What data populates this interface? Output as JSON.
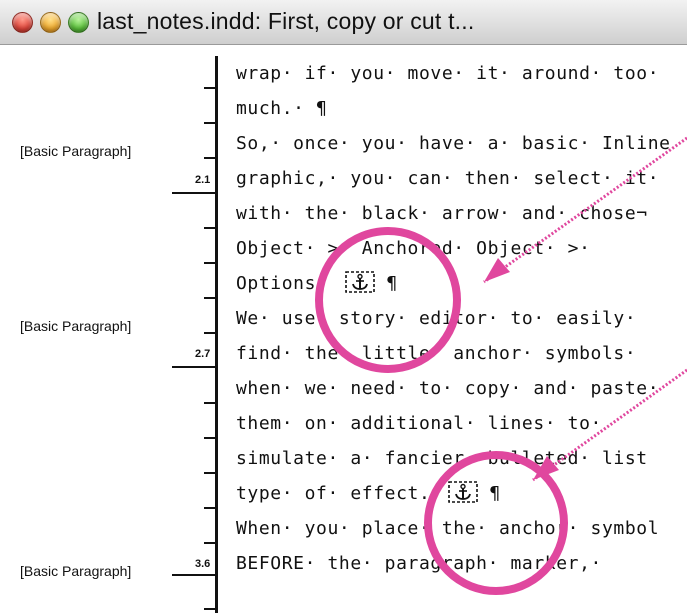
{
  "window": {
    "title": "last_notes.indd: First, copy or cut t..."
  },
  "gutter": {
    "styles": [
      {
        "label": "[Basic Paragraph]",
        "depth": "2.1"
      },
      {
        "label": "[Basic Paragraph]",
        "depth": "2.7"
      },
      {
        "label": "[Basic Paragraph]",
        "depth": "3.6"
      }
    ]
  },
  "story": {
    "lines": [
      "wrap· if· you· move· it· around· too·",
      "much.· ¶",
      "So,· once· you· have· a· basic· Inline",
      "graphic,· you· can· then· select· it·",
      "with· the· black· arrow· and· chose¬",
      "Object· >· Anchored· Object· >·",
      "Options.",
      "¶",
      "We· use· story· editor· to· easily·",
      "find· the· little· anchor· symbols·",
      "when· we· need· to· copy· and· paste·",
      "them· on· additional· lines· to·",
      "simulate· a· fancier· bulleted· list",
      "type· of· effect.",
      "¶",
      "When· you· place· the· anchor· symbol",
      "BEFORE· the· paragraph· marker,·"
    ],
    "anchor_icon": "anchor-icon"
  },
  "annotations": {
    "color": "#e0479e"
  }
}
